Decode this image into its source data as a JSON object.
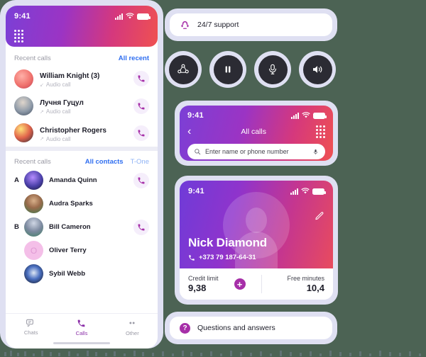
{
  "left_phone": {
    "status": {
      "time": "9:41",
      "signal_icon": "signal-bars-icon",
      "wifi_icon": "wifi-icon",
      "battery_icon": "battery-icon"
    },
    "dialpad_icon": "dialpad-icon",
    "recent": {
      "title": "Recent calls",
      "action": "All recent",
      "items": [
        {
          "name": "William Knight (3)",
          "sub": "Audio call",
          "direction": "incoming",
          "call_icon": "phone-call-icon"
        },
        {
          "name": "Лучня Гуцул",
          "sub": "Audio call",
          "direction": "outgoing",
          "call_icon": "phone-call-icon"
        },
        {
          "name": "Christopher Rogers",
          "sub": "Audio call",
          "direction": "outgoing",
          "call_icon": "phone-call-icon"
        }
      ]
    },
    "contacts": {
      "title": "Recent calls",
      "action_primary": "All contacts",
      "action_secondary": "T-One",
      "groups": [
        {
          "letter": "A",
          "name": "Amanda Quinn",
          "has_call": true
        },
        {
          "letter": "",
          "name": "Audra Sparks",
          "has_call": false
        },
        {
          "letter": "B",
          "name": "Bill Cameron",
          "has_call": true
        },
        {
          "letter": "",
          "name": "Oliver Terry",
          "has_call": false,
          "initial": "O"
        },
        {
          "letter": "",
          "name": "Sybil Webb",
          "has_call": false
        }
      ]
    },
    "tabs": [
      {
        "label": "Chats",
        "icon": "chats-icon",
        "active": false
      },
      {
        "label": "Calls",
        "icon": "phone-call-icon",
        "active": true
      },
      {
        "label": "Other",
        "icon": "more-dots-icon",
        "active": false
      }
    ]
  },
  "support_bar": {
    "label": "24/7 support",
    "icon": "support-agent-icon"
  },
  "call_controls": [
    {
      "name": "add-participant",
      "icon": "add-participant-icon"
    },
    {
      "name": "pause-call",
      "icon": "pause-icon"
    },
    {
      "name": "mute-microphone",
      "icon": "microphone-icon"
    },
    {
      "name": "speaker",
      "icon": "speaker-icon"
    }
  ],
  "all_calls_phone": {
    "status": {
      "time": "9:41"
    },
    "back_icon": "back-chevron-icon",
    "title": "All calls",
    "dialpad_icon": "dialpad-icon",
    "search": {
      "placeholder": "Enter name or phone number",
      "icon": "search-icon",
      "mic_icon": "microphone-icon"
    }
  },
  "contact_card": {
    "status": {
      "time": "9:41"
    },
    "edit_icon": "pencil-edit-icon",
    "avatar_icon": "person-avatar-icon",
    "name": "Nick Diamond",
    "phone": "+373 79 187-64-31",
    "phone_icon": "phone-handset-icon",
    "credit": {
      "label": "Credit limit",
      "value": "9,38"
    },
    "add_icon": "plus-circle-icon",
    "minutes": {
      "label": "Free minutes",
      "value": "10,4"
    }
  },
  "qa_bar": {
    "label": "Questions and answers",
    "icon": "question-mark-icon"
  },
  "colors": {
    "accent_purple": "#a62fa8",
    "link_blue": "#2f6ef0",
    "frame_lilac": "#dfe0f2",
    "dark_button": "#2b2b33",
    "background_green": "#4c6354"
  }
}
